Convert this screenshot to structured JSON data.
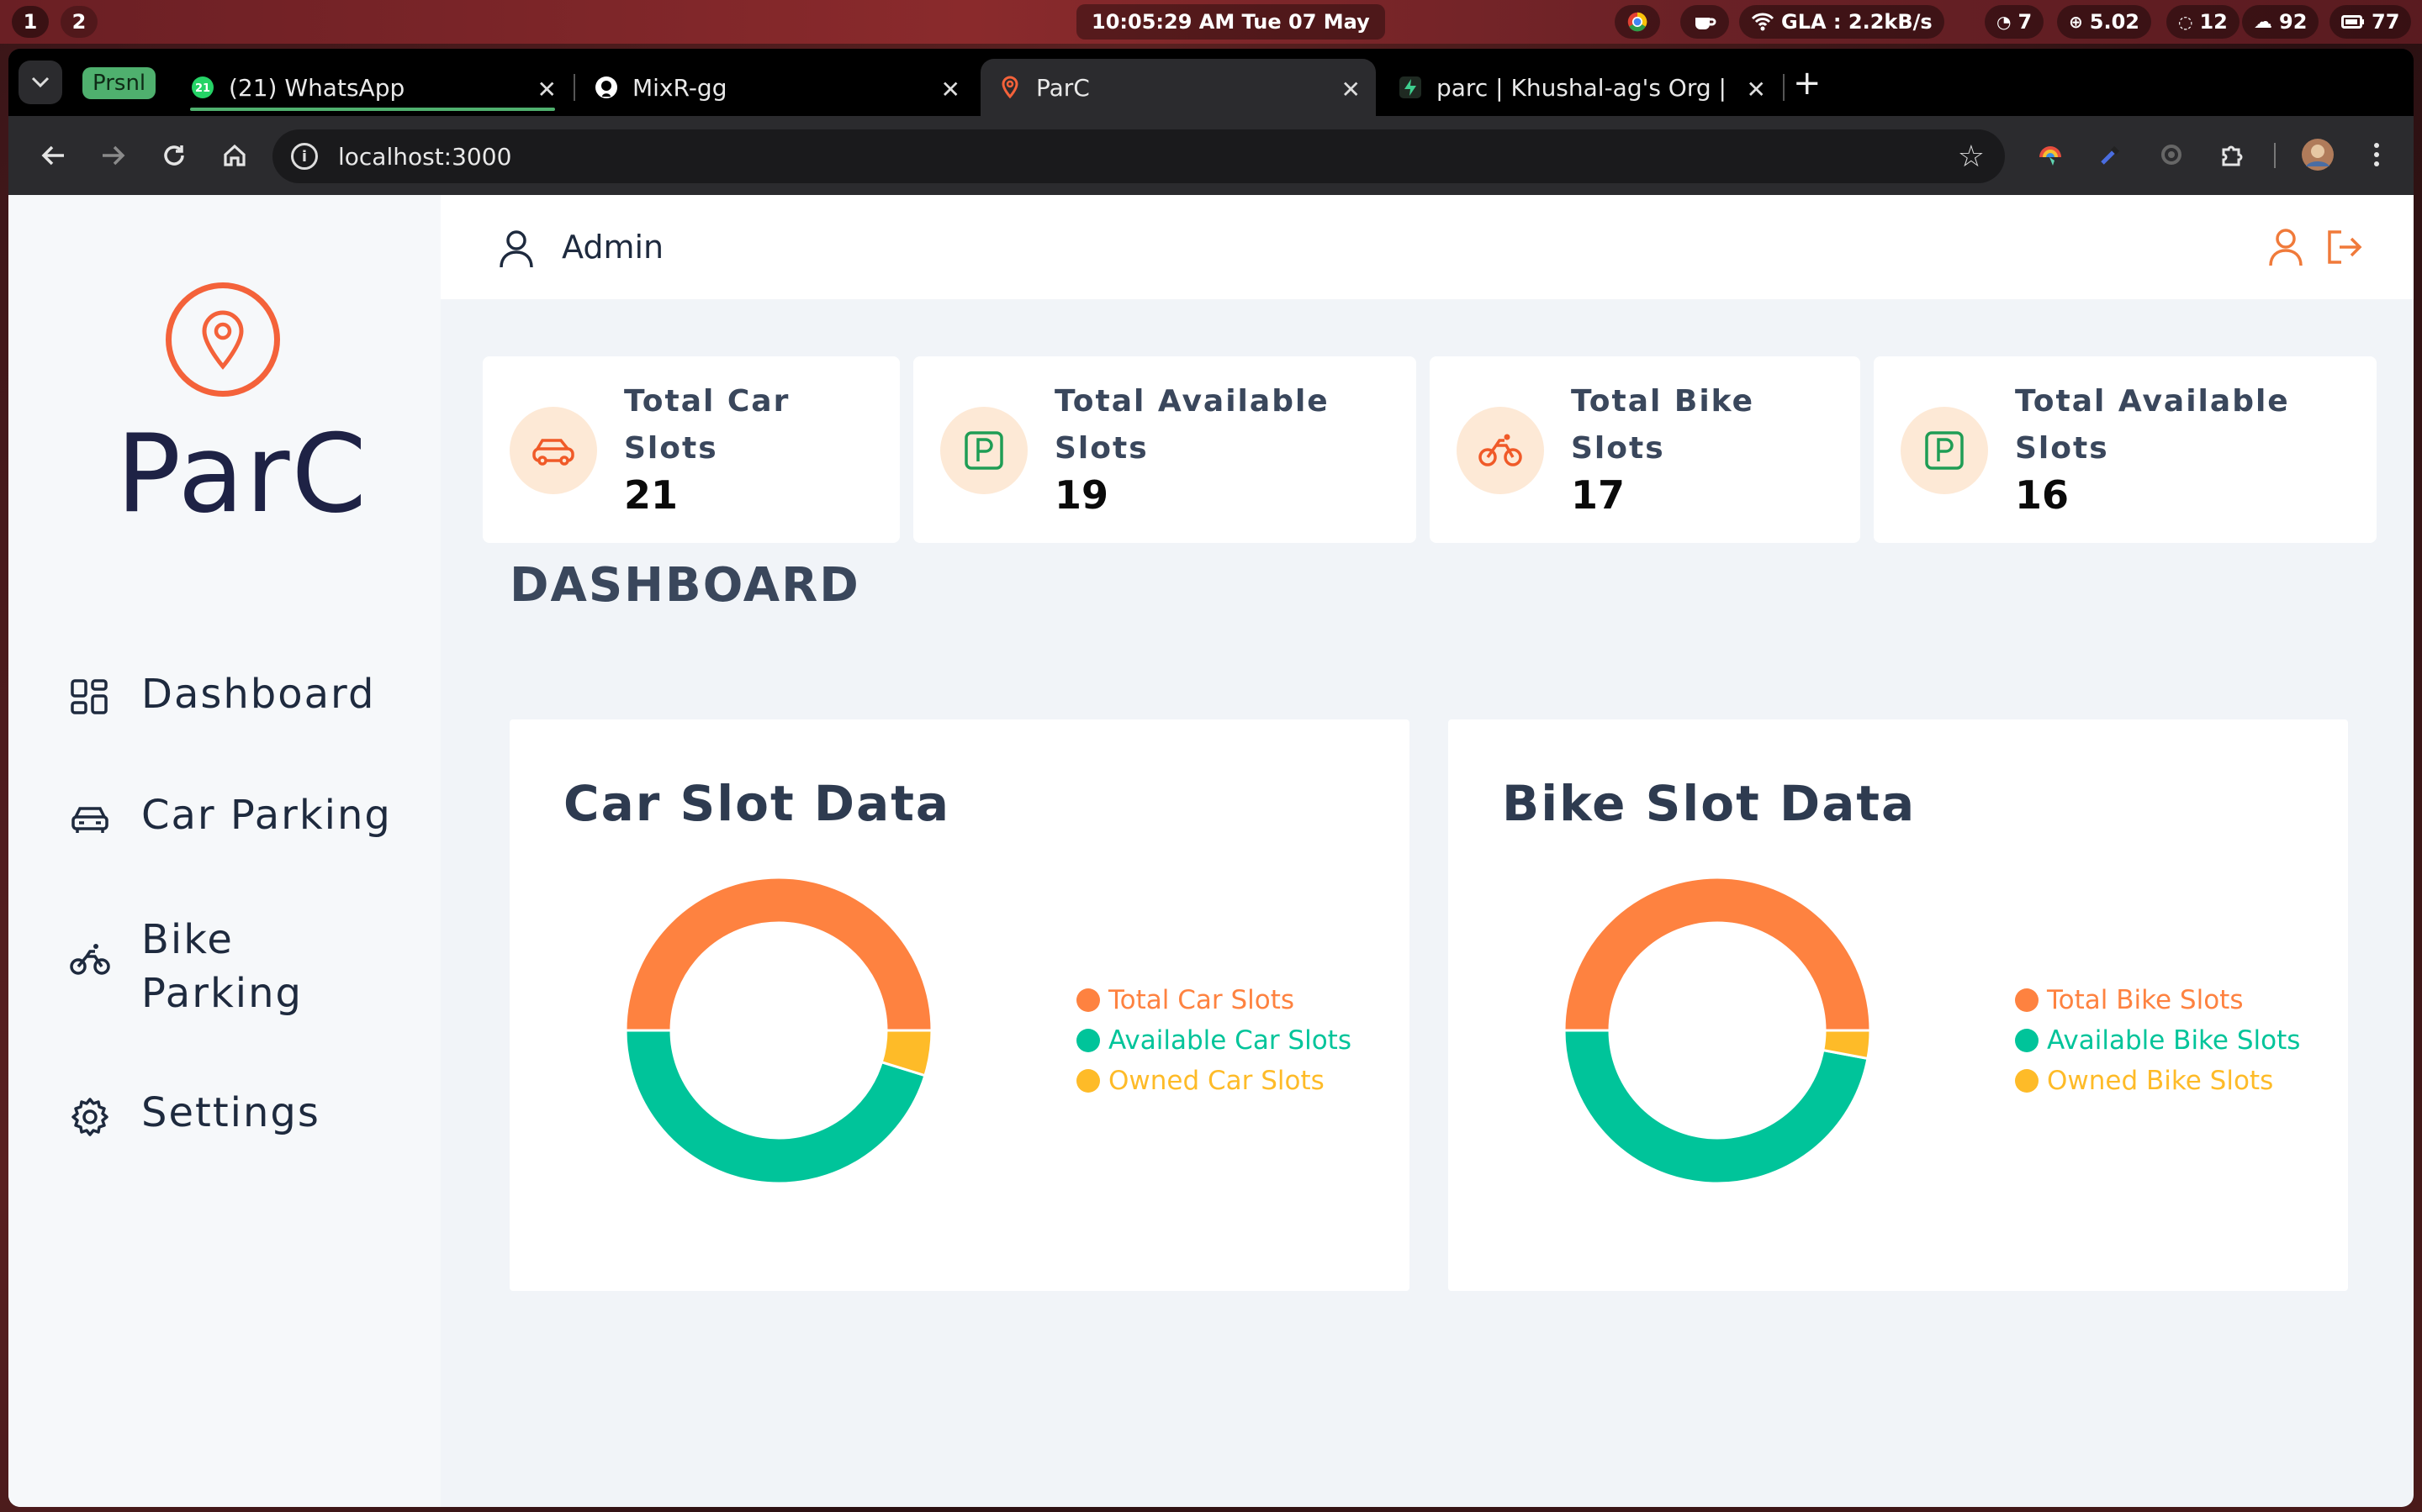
{
  "system_bar": {
    "workspaces": [
      "1",
      "2"
    ],
    "clock": "10:05:29 AM  Tue 07 May",
    "network": "GLA : 2.2kB/s",
    "stats": [
      "7",
      "5.02",
      "12",
      "92",
      "77"
    ]
  },
  "browser": {
    "tab_group": "Prsnl",
    "tabs": [
      {
        "title": "(21) WhatsApp",
        "badge": "21"
      },
      {
        "title": "MixR-gg"
      },
      {
        "title": "ParC"
      },
      {
        "title": "parc | Khushal-ag's Org |"
      }
    ],
    "url": "localhost:3000"
  },
  "app": {
    "brand": "ParC",
    "nav": [
      {
        "label": "Dashboard",
        "icon": "grid-icon"
      },
      {
        "label": "Car Parking",
        "icon": "car-icon"
      },
      {
        "label": "Bike\nParking",
        "icon": "bike-icon"
      },
      {
        "label": "Settings",
        "icon": "gear-icon"
      }
    ],
    "header": {
      "user": "Admin"
    },
    "stats": [
      {
        "label": "Total Car\nSlots",
        "value": "21",
        "icon": "car-icon"
      },
      {
        "label": "Total Available\nSlots",
        "value": "19",
        "icon": "parking-icon"
      },
      {
        "label": "Total Bike\nSlots",
        "value": "17",
        "icon": "bike-icon"
      },
      {
        "label": "Total Available\nSlots",
        "value": "16",
        "icon": "parking-icon"
      }
    ],
    "dashboard_title": "DASHBOARD",
    "colors": {
      "accent": "#f4623a",
      "orange": "#fe8240",
      "teal": "#00c49a",
      "yellow": "#febb28",
      "green": "#1f9d55"
    }
  },
  "chart_data": [
    {
      "type": "pie",
      "title": "Car Slot Data",
      "labels": [
        "Total Car Slots",
        "Available Car Slots",
        "Owned Car Slots"
      ],
      "values": [
        21,
        19,
        2
      ],
      "colors": [
        "#fe8240",
        "#00c49a",
        "#febb28"
      ]
    },
    {
      "type": "pie",
      "title": "Bike Slot Data",
      "labels": [
        "Total Bike Slots",
        "Available Bike Slots",
        "Owned Bike Slots"
      ],
      "values": [
        17,
        16,
        1
      ],
      "colors": [
        "#fe8240",
        "#00c49a",
        "#febb28"
      ]
    }
  ]
}
